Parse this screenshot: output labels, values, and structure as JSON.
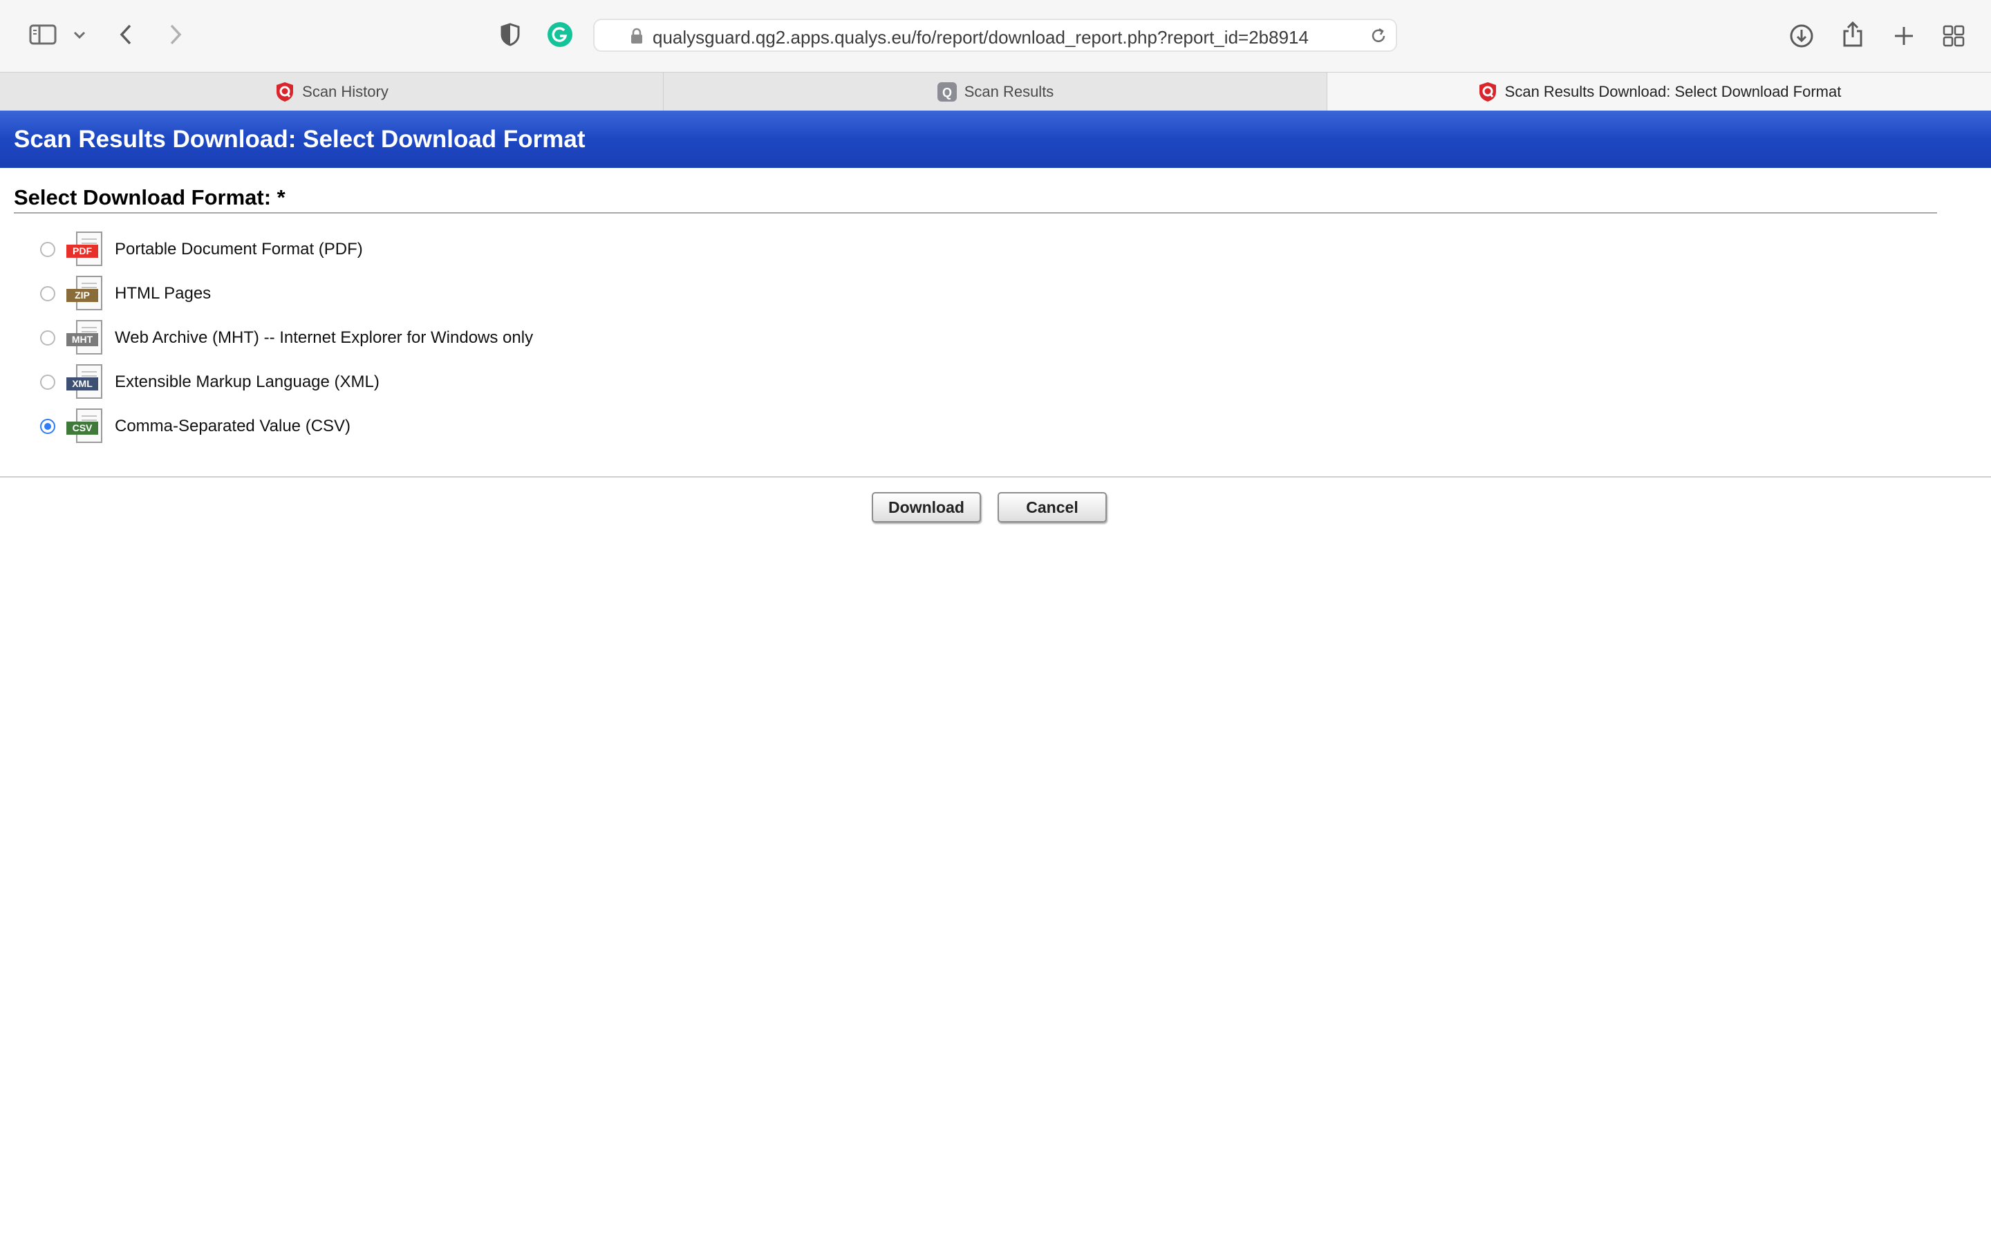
{
  "browser": {
    "url": "qualysguard.qg2.apps.qualys.eu/fo/report/download_report.php?report_id=2b8914",
    "tabs": [
      {
        "label": "Scan History",
        "active": false,
        "favicon": "qualys-shield-icon"
      },
      {
        "label": "Scan Results",
        "active": false,
        "favicon": "qualys-gray-icon"
      },
      {
        "label": "Scan Results Download: Select Download Format",
        "active": true,
        "favicon": "qualys-shield-icon"
      }
    ]
  },
  "page": {
    "header_title": "Scan Results Download: Select Download Format",
    "section_title": "Select Download Format: *",
    "formats": [
      {
        "badge": "PDF",
        "label": "Portable Document Format (PDF)",
        "selected": false,
        "badge_color": "#e8302a"
      },
      {
        "badge": "ZIP",
        "label": "HTML Pages",
        "selected": false,
        "badge_color": "#8a6b3a"
      },
      {
        "badge": "MHT",
        "label": "Web Archive (MHT) -- Internet Explorer for Windows only",
        "selected": false,
        "badge_color": "#7a7a7a"
      },
      {
        "badge": "XML",
        "label": "Extensible Markup Language (XML)",
        "selected": false,
        "badge_color": "#3d4f73"
      },
      {
        "badge": "CSV",
        "label": "Comma-Separated Value (CSV)",
        "selected": true,
        "badge_color": "#3f7a3a"
      }
    ],
    "download_label": "Download",
    "cancel_label": "Cancel"
  },
  "colors": {
    "header_blue": "#1d47c2",
    "radio_selected": "#2f7cf6"
  }
}
